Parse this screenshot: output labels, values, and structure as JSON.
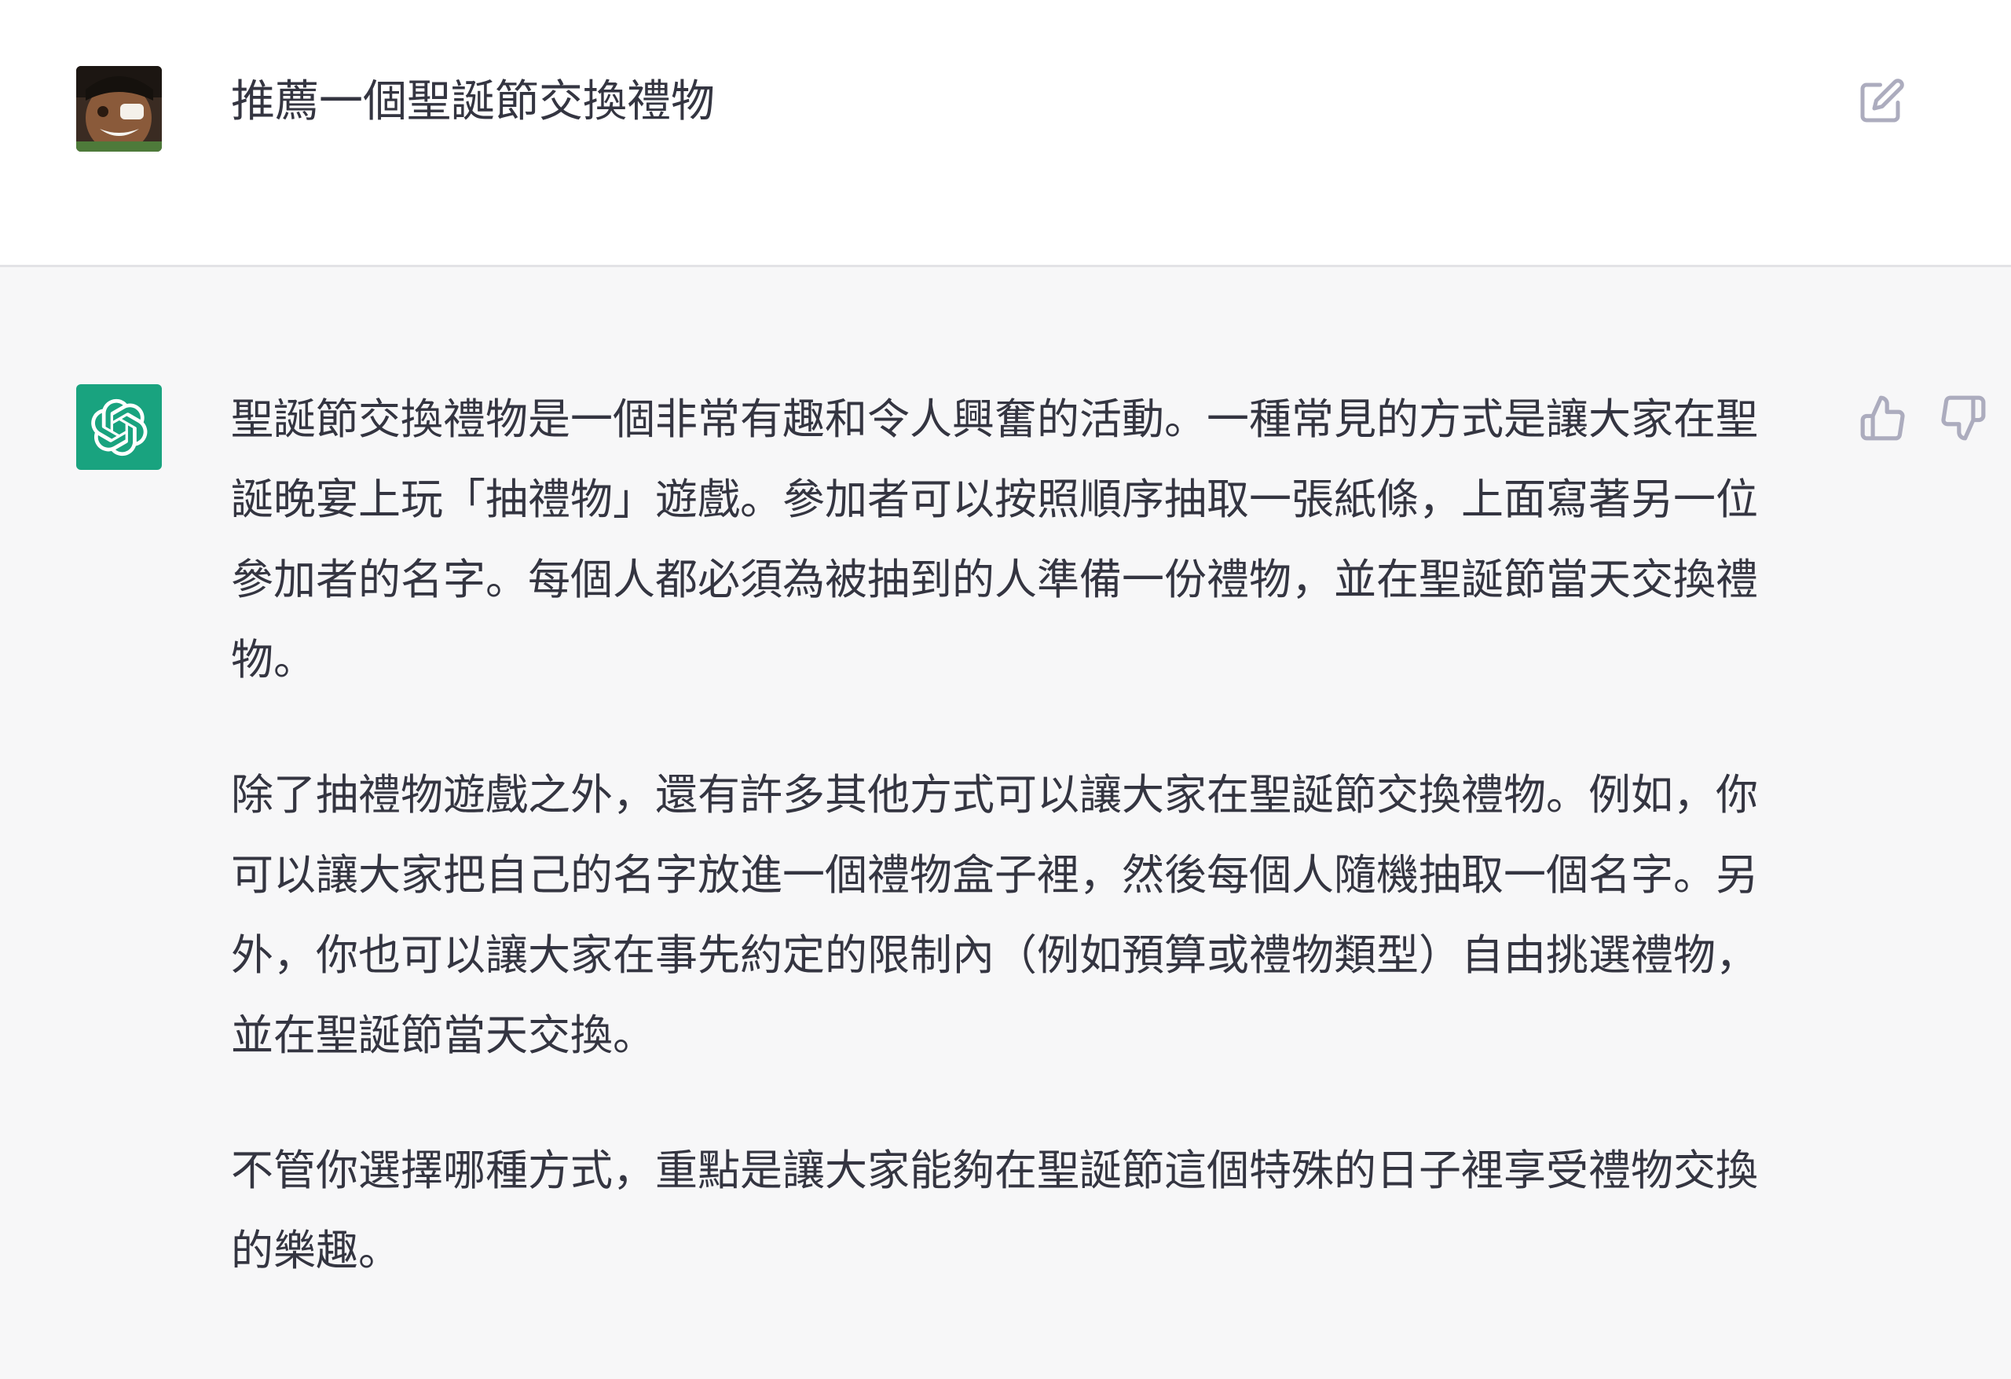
{
  "user_message": {
    "text": "推薦一個聖誕節交換禮物"
  },
  "assistant_message": {
    "paragraphs": [
      "聖誕節交換禮物是一個非常有趣和令人興奮的活動。一種常見的方式是讓大家在聖誕晚宴上玩「抽禮物」遊戲。參加者可以按照順序抽取一張紙條，上面寫著另一位參加者的名字。每個人都必須為被抽到的人準備一份禮物，並在聖誕節當天交換禮物。",
      "除了抽禮物遊戲之外，還有許多其他方式可以讓大家在聖誕節交換禮物。例如，你可以讓大家把自己的名字放進一個禮物盒子裡，然後每個人隨機抽取一個名字。另外，你也可以讓大家在事先約定的限制內（例如預算或禮物類型）自由挑選禮物，並在聖誕節當天交換。",
      "不管你選擇哪種方式，重點是讓大家能夠在聖誕節這個特殊的日子裡享受禮物交換的樂趣。"
    ]
  },
  "icons": {
    "edit": "edit-icon",
    "thumb_up": "thumbs-up-icon",
    "thumb_down": "thumbs-down-icon",
    "assistant_logo": "openai-logo-icon",
    "user_avatar": "user-avatar"
  },
  "colors": {
    "assistant_logo_bg": "#19a37f",
    "page_bg": "#f7f7f8",
    "user_row_bg": "#ffffff",
    "text": "#343541",
    "icon": "#acacbe"
  }
}
